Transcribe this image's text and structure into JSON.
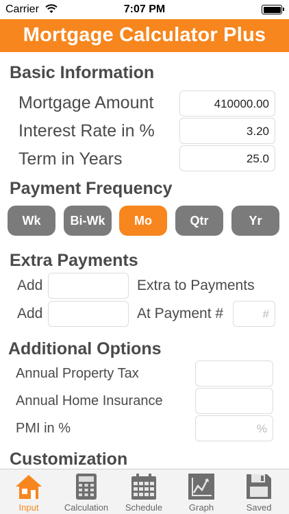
{
  "status_bar": {
    "carrier": "Carrier",
    "time": "7:07 PM"
  },
  "header": {
    "title": "Mortgage Calculator Plus"
  },
  "basic_info": {
    "title": "Basic Information",
    "mortgage_amount": {
      "label": "Mortgage Amount",
      "value": "410000.00"
    },
    "interest_rate": {
      "label": "Interest Rate in %",
      "value": "3.20"
    },
    "term_years": {
      "label": "Term in Years",
      "value": "25.0"
    }
  },
  "payment_frequency": {
    "title": "Payment Frequency",
    "options": [
      {
        "label": "Wk"
      },
      {
        "label": "Bi-Wk"
      },
      {
        "label": "Mo"
      },
      {
        "label": "Qtr"
      },
      {
        "label": "Yr"
      }
    ],
    "selected": "Mo"
  },
  "extra_payments": {
    "title": "Extra Payments",
    "row1": {
      "prefix": "Add",
      "value": "",
      "suffix": "Extra to Payments"
    },
    "row2": {
      "prefix": "Add",
      "value": "",
      "suffix": "At Payment #",
      "placeholder": "#"
    }
  },
  "additional_options": {
    "title": "Additional Options",
    "property_tax": {
      "label": "Annual Property Tax",
      "value": ""
    },
    "home_insurance": {
      "label": "Annual Home Insurance",
      "value": ""
    },
    "pmi": {
      "label": "PMI in %",
      "placeholder": "%"
    }
  },
  "customization": {
    "title": "Customization"
  },
  "tabs": [
    {
      "label": "Input",
      "icon": "house-icon"
    },
    {
      "label": "Calculation",
      "icon": "calculator-icon"
    },
    {
      "label": "Schedule",
      "icon": "calendar-icon"
    },
    {
      "label": "Graph",
      "icon": "line-graph-icon"
    },
    {
      "label": "Saved",
      "icon": "floppy-disk-icon"
    }
  ],
  "colors": {
    "accent": "#f7861e",
    "button_gray": "#7b7b7b",
    "text": "#4a4a4a"
  }
}
